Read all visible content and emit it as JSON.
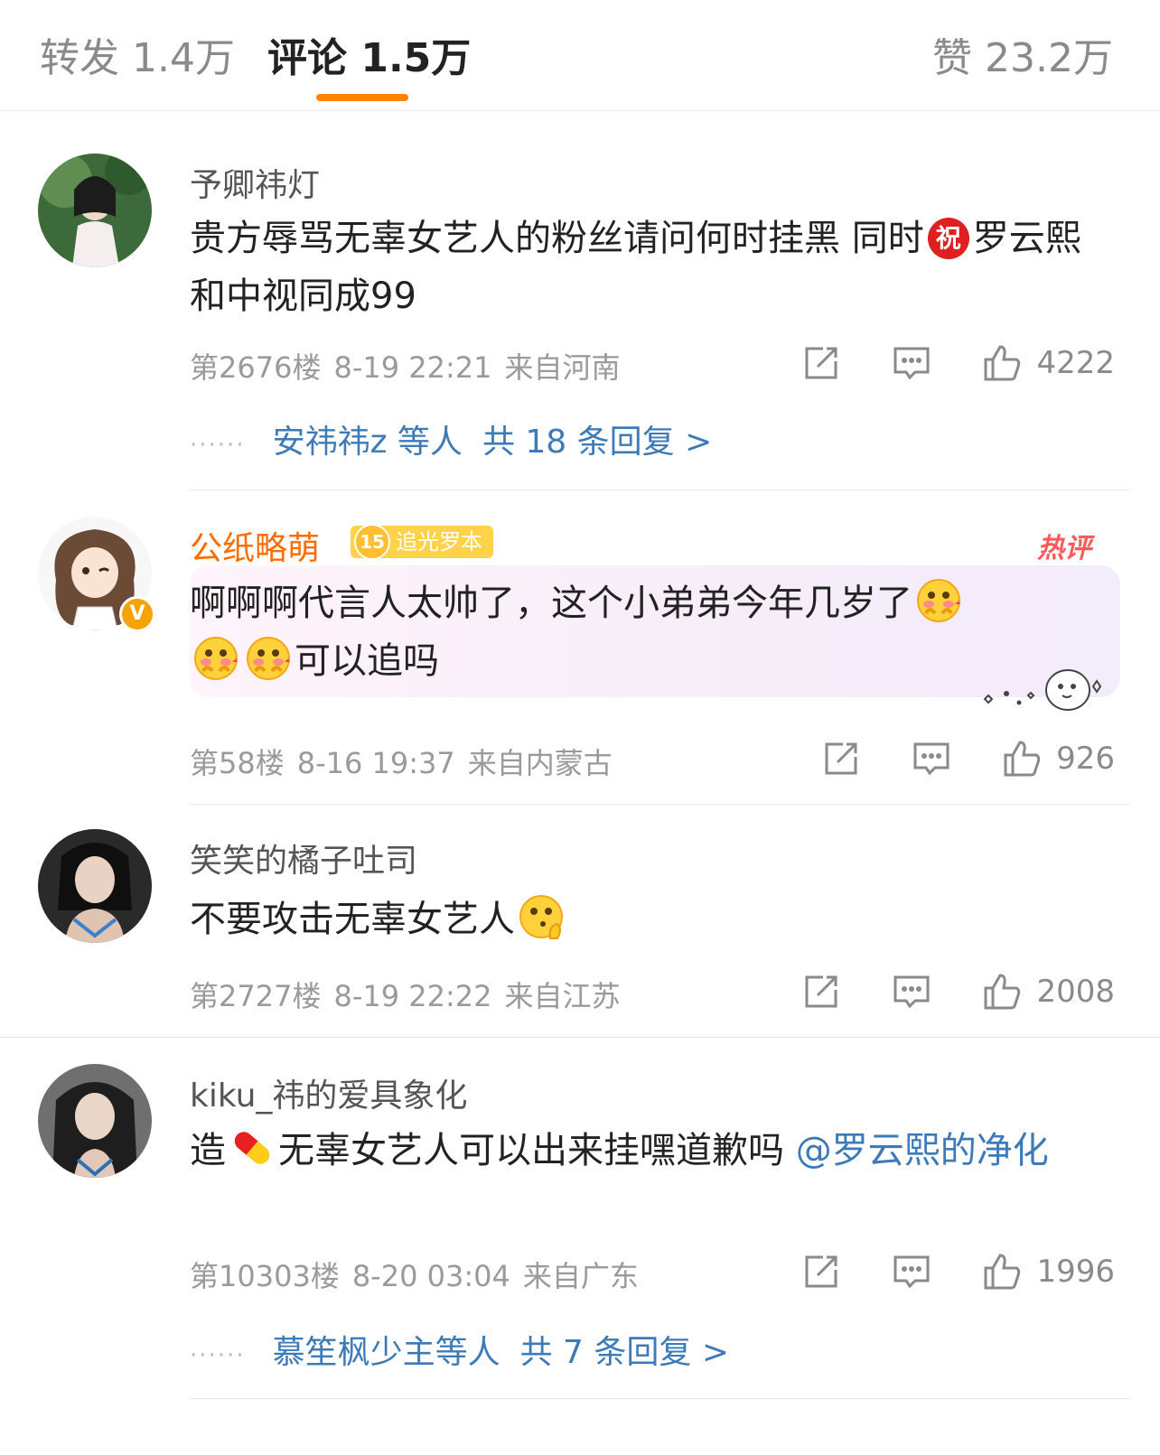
{
  "tabs": {
    "repost_label": "转发",
    "repost_count": "1.4万",
    "comment_label": "评论",
    "comment_count": "1.5万",
    "like_label": "赞",
    "like_count": "23.2万",
    "accent": "#ff8200"
  },
  "comments": [
    {
      "username": "予卿祎灯",
      "text_a": "贵方辱骂无辜女艺人的粉丝请问何时挂黑 同时",
      "zhu": "祝",
      "text_b": "罗云熙和中视同成99",
      "floor": "第2676楼",
      "time": "8-19 22:21",
      "location": "来自河南",
      "likes": "4222",
      "replies_users": "安祎祎z 等人",
      "replies_total": "共 18 条回复 >"
    },
    {
      "username": "公纸略萌",
      "fan_level": "15",
      "fan_badge": "追光罗本",
      "hot_tag": "热评",
      "text_a": "啊啊啊代言人太帅了，这个小弟弟今年几岁了",
      "text_b": "可以追吗",
      "emoji": "blush-hands",
      "floor": "第58楼",
      "time": "8-16 19:37",
      "location": "来自内蒙古",
      "likes": "926"
    },
    {
      "username": "笑笑的橘子吐司",
      "text_a": "不要攻击无辜女艺人",
      "emoji": "thinking",
      "floor": "第2727楼",
      "time": "8-19 22:22",
      "location": "来自江苏",
      "likes": "2008"
    },
    {
      "username": "kiku_祎的爱具象化",
      "text_a": "造",
      "emoji": "pill",
      "text_b": "无辜女艺人可以出来挂嘿道歉吗 ",
      "mention": "@罗云熙的净化",
      "floor": "第10303楼",
      "time": "8-20 03:04",
      "location": "来自广东",
      "likes": "1996",
      "replies_users": "慕笙枫少主等人",
      "replies_total": "共 7 条回复 >"
    }
  ],
  "icons": [
    "share-icon",
    "comment-icon",
    "like-icon"
  ],
  "colors": {
    "link": "#3d7ab8",
    "hot": "#ff5a5a",
    "username_hot": "#ff6c00",
    "meta": "#9a9a9a"
  }
}
